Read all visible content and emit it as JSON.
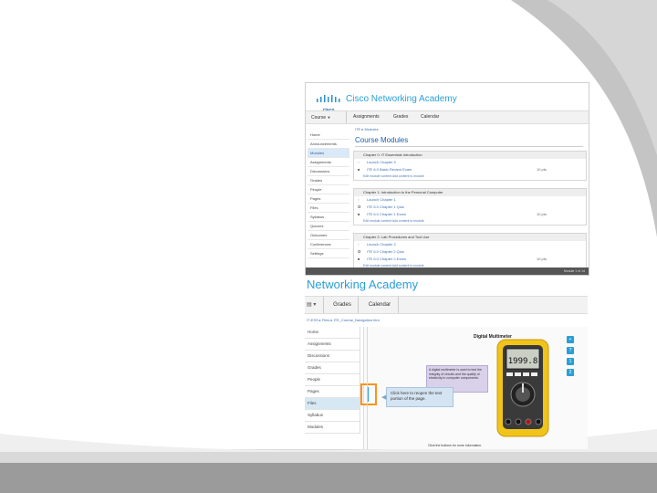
{
  "top_screenshot": {
    "logo": {
      "company": "cisco",
      "title": "Cisco Networking Academy"
    },
    "menu": {
      "course": "Course",
      "assignments": "Assignments",
      "grades": "Grades",
      "calendar": "Calendar"
    },
    "breadcrumb": "ITE ▸ Modules",
    "page_title": "Course Modules",
    "sidebar": [
      "Home",
      "Announcements",
      "Modules",
      "Assignments",
      "Discussions",
      "Grades",
      "People",
      "Pages",
      "Files",
      "Syllabus",
      "Quizzes",
      "Outcomes",
      "Conferences",
      "Settings"
    ],
    "chapters": [
      {
        "title": "Chapter 0: IT Essentials Introduction",
        "rows": [
          {
            "label": "Launch Chapter 0",
            "meta": ""
          },
          {
            "label": "ITE 6.0 Basic Review Exam",
            "meta": "10 pts"
          }
        ],
        "footer": "Edit module content   Add content to module"
      },
      {
        "title": "Chapter 1: Introduction to the Personal Computer",
        "rows": [
          {
            "label": "Launch Chapter 1",
            "meta": ""
          },
          {
            "label": "ITE 6.0 Chapter 1 Quiz",
            "meta": ""
          },
          {
            "label": "ITE 6.0 Chapter 1 Exam",
            "meta": "10 pts"
          }
        ],
        "footer": "Edit module content   Add content to module"
      },
      {
        "title": "Chapter 2: Lab Procedures and Tool Use",
        "rows": [
          {
            "label": "Launch Chapter 2",
            "meta": ""
          },
          {
            "label": "ITE 6.0 Chapter 2 Quiz",
            "meta": ""
          },
          {
            "label": "ITE 6.0 Chapter 2 Exam",
            "meta": "10 pts"
          }
        ],
        "footer": "Edit module content   Add content to module"
      }
    ],
    "status_bar": "Module 1 of 14"
  },
  "bottom_screenshot": {
    "logo": "Networking Academy",
    "menu": {
      "grades": "Grades",
      "calendar": "Calendar"
    },
    "breadcrumb": "IT-ESS ▸ Files ▸ ITE_Course_Navigation.htm",
    "sidebar": [
      "Home",
      "Assignments",
      "Discussions",
      "Grades",
      "People",
      "Pages",
      "Files",
      "Syllabus",
      "Modules"
    ],
    "selected_nav": "Files",
    "content": {
      "title": "Digital Multimeter",
      "info_text": "A digital multimeter is used to test the integrity of circuits and the quality of electricity in computer components.",
      "callout": "Click here to reopen the text portion of the page.",
      "footer": "Click the buttons for more information.",
      "display_reading": "1999.8",
      "side_buttons": [
        "+",
        "?",
        "1",
        "2"
      ]
    }
  },
  "colors": {
    "primary_blue": "#2a9fd6",
    "cisco_blue": "#1e5fa8",
    "selected_nav_bg": "#d9e9f7",
    "callout_bg": "#d5e4f2",
    "meter_yellow": "#f0c419",
    "info_box": "#d9d1ea",
    "highlight_orange": "#f7941d"
  }
}
